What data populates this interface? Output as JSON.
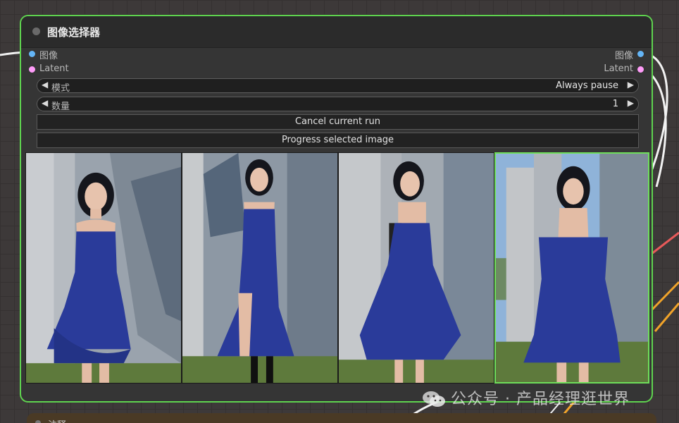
{
  "node": {
    "title": "图像选择器",
    "inputs": [
      {
        "label": "图像",
        "color": "#64b5f6"
      },
      {
        "label": "Latent",
        "color": "#ff9cf9"
      }
    ],
    "outputs": [
      {
        "label": "图像",
        "color": "#64b5f6"
      },
      {
        "label": "Latent",
        "color": "#ff9cf9"
      }
    ],
    "widgets": [
      {
        "label": "模式",
        "value": "Always pause"
      },
      {
        "label": "数量",
        "value": "1"
      }
    ],
    "buttons": {
      "cancel": "Cancel current run",
      "progress": "Progress selected image"
    },
    "images": [
      {
        "selected": false
      },
      {
        "selected": false
      },
      {
        "selected": false
      },
      {
        "selected": true
      }
    ],
    "accent_color": "#5fd34f"
  },
  "next_node": {
    "title": "注释"
  },
  "watermark": {
    "text": "公众号 · 产品经理逛世界",
    "icon": "wechat-icon"
  }
}
